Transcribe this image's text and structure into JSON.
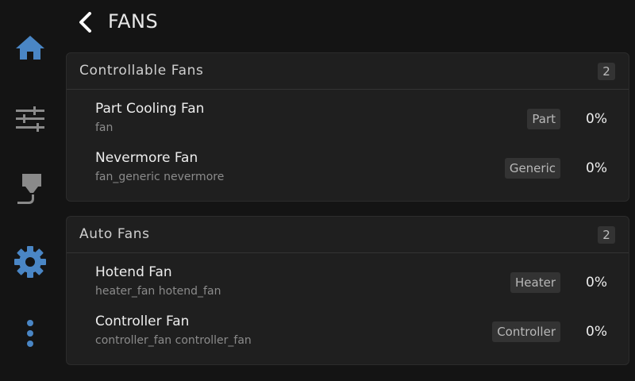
{
  "sidebar": {
    "items": [
      {
        "name": "home",
        "icon": "home-icon",
        "color": "#4a86c5"
      },
      {
        "name": "controls",
        "icon": "sliders-icon",
        "color": "#8a8a8a"
      },
      {
        "name": "filament",
        "icon": "extruder-icon",
        "color": "#8a8a8a"
      },
      {
        "name": "settings",
        "icon": "gear-icon",
        "color": "#4a86c5",
        "active": true
      },
      {
        "name": "more",
        "icon": "more-vertical-icon",
        "color": "#4a86c5"
      }
    ]
  },
  "header": {
    "back_icon": "chevron-left-icon",
    "title": "FANS"
  },
  "sections": [
    {
      "title": "Controllable Fans",
      "count": "2",
      "fans": [
        {
          "name": "Part Cooling Fan",
          "id": "fan",
          "type": "Part",
          "speed": "0%"
        },
        {
          "name": "Nevermore Fan",
          "id": "fan_generic nevermore",
          "type": "Generic",
          "speed": "0%"
        }
      ]
    },
    {
      "title": "Auto Fans",
      "count": "2",
      "fans": [
        {
          "name": "Hotend Fan",
          "id": "heater_fan hotend_fan",
          "type": "Heater",
          "speed": "0%"
        },
        {
          "name": "Controller Fan",
          "id": "controller_fan controller_fan",
          "type": "Controller",
          "speed": "0%"
        }
      ]
    }
  ],
  "colors": {
    "accent": "#4a86c5",
    "background": "#141414",
    "card": "#1f1f1f"
  }
}
